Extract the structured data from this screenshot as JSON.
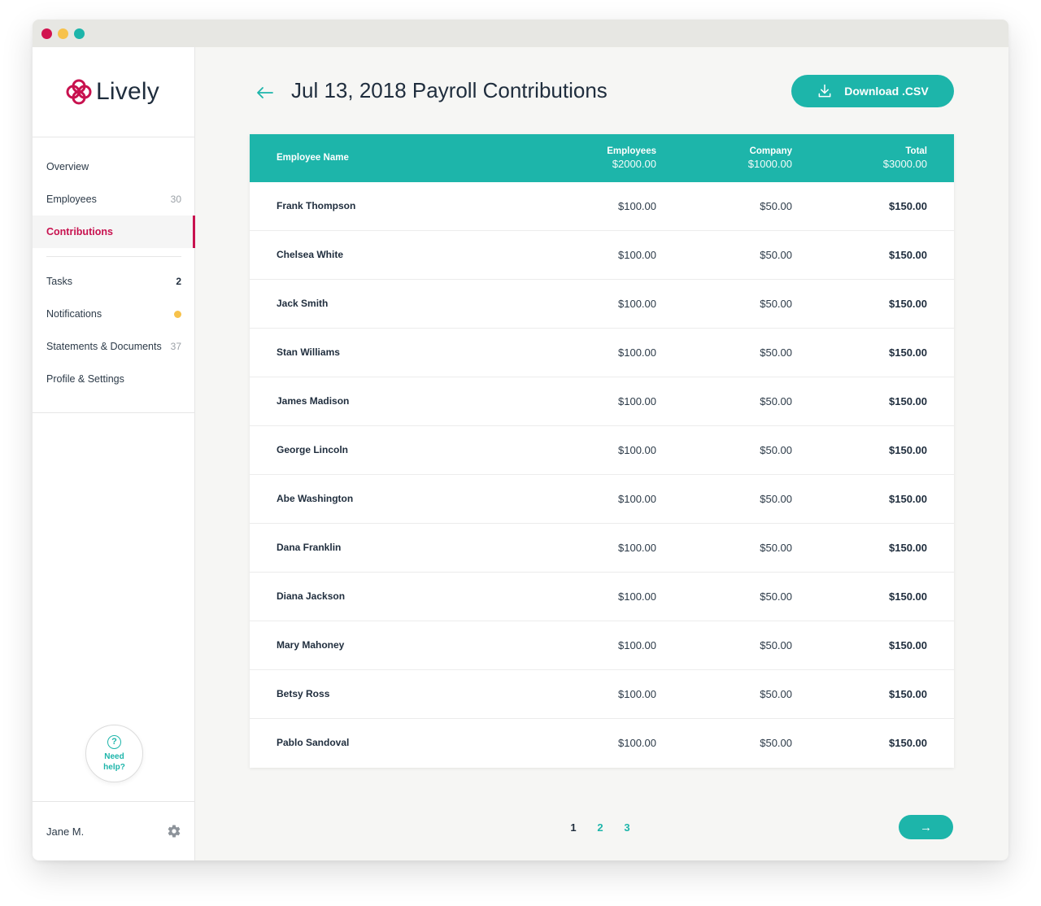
{
  "window": {
    "controls": [
      {
        "name": "close",
        "color": "#d1134f"
      },
      {
        "name": "minimize",
        "color": "#f7c24b"
      },
      {
        "name": "zoom",
        "color": "#1db5aa"
      }
    ]
  },
  "brand": {
    "name": "Lively",
    "accent": "#c8124f",
    "primary": "#1db5aa"
  },
  "sidebar": {
    "items": [
      {
        "label": "Overview",
        "count": "",
        "active": false
      },
      {
        "label": "Employees",
        "count": "30",
        "active": false
      },
      {
        "label": "Contributions",
        "count": "",
        "active": true
      }
    ],
    "items2": [
      {
        "label": "Tasks",
        "count": "2",
        "style": "bold"
      },
      {
        "label": "Notifications",
        "count": "",
        "style": "dot"
      },
      {
        "label": "Statements & Documents",
        "count": "37",
        "style": "muted"
      },
      {
        "label": "Profile & Settings",
        "count": "",
        "style": "none"
      }
    ],
    "help": {
      "line1": "Need",
      "line2": "help?",
      "icon": "question-circle-icon"
    },
    "user": {
      "name": "Jane M.",
      "icon": "gear-icon"
    }
  },
  "header": {
    "title": "Jul 13, 2018 Payroll Contributions",
    "back_icon": "arrow-left-icon",
    "download_label": "Download .CSV",
    "download_icon": "download-icon"
  },
  "table": {
    "columns": {
      "name": {
        "label": "Employee Name"
      },
      "employees": {
        "label": "Employees",
        "total": "$2000.00"
      },
      "company": {
        "label": "Company",
        "total": "$1000.00"
      },
      "total": {
        "label": "Total",
        "total": "$3000.00"
      }
    },
    "rows": [
      {
        "name": "Frank Thompson",
        "employees": "$100.00",
        "company": "$50.00",
        "total": "$150.00"
      },
      {
        "name": "Chelsea White",
        "employees": "$100.00",
        "company": "$50.00",
        "total": "$150.00"
      },
      {
        "name": "Jack Smith",
        "employees": "$100.00",
        "company": "$50.00",
        "total": "$150.00"
      },
      {
        "name": "Stan Williams",
        "employees": "$100.00",
        "company": "$50.00",
        "total": "$150.00"
      },
      {
        "name": "James Madison",
        "employees": "$100.00",
        "company": "$50.00",
        "total": "$150.00"
      },
      {
        "name": "George Lincoln",
        "employees": "$100.00",
        "company": "$50.00",
        "total": "$150.00"
      },
      {
        "name": "Abe Washington",
        "employees": "$100.00",
        "company": "$50.00",
        "total": "$150.00"
      },
      {
        "name": "Dana Franklin",
        "employees": "$100.00",
        "company": "$50.00",
        "total": "$150.00"
      },
      {
        "name": "Diana Jackson",
        "employees": "$100.00",
        "company": "$50.00",
        "total": "$150.00"
      },
      {
        "name": "Mary Mahoney",
        "employees": "$100.00",
        "company": "$50.00",
        "total": "$150.00"
      },
      {
        "name": "Betsy Ross",
        "employees": "$100.00",
        "company": "$50.00",
        "total": "$150.00"
      },
      {
        "name": "Pablo Sandoval",
        "employees": "$100.00",
        "company": "$50.00",
        "total": "$150.00"
      }
    ]
  },
  "pagination": {
    "pages": [
      "1",
      "2",
      "3"
    ],
    "current": "1",
    "next_label": "→",
    "next_icon": "arrow-right-icon"
  }
}
